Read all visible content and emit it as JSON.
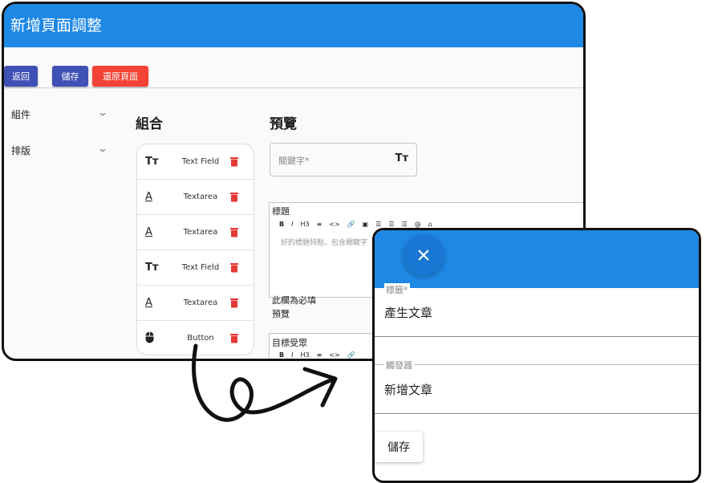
{
  "app": {
    "title": "新增頁面調整"
  },
  "toolbar": {
    "back_label": "返回",
    "save_label": "儲存",
    "reset_label": "還原頁面",
    "colors": {
      "primary": "#3f51b5",
      "danger": "#f44336"
    }
  },
  "sidebar": {
    "items": [
      {
        "label": "組件"
      },
      {
        "label": "排版"
      }
    ]
  },
  "palette": {
    "title": "組合",
    "items": [
      {
        "icon": "text-field-icon",
        "label": "Text Field"
      },
      {
        "icon": "textarea-icon",
        "label": "Textarea"
      },
      {
        "icon": "textarea-icon",
        "label": "Textarea"
      },
      {
        "icon": "text-field-icon",
        "label": "Text Field"
      },
      {
        "icon": "textarea-icon",
        "label": "Textarea"
      },
      {
        "icon": "mouse-icon",
        "label": "Button"
      }
    ]
  },
  "preview": {
    "title": "預覽",
    "keyword_placeholder": "關鍵字*",
    "editor1": {
      "label": "標題",
      "placeholder": "好的標題特點，包含關鍵字",
      "required_note": "此欄為必填",
      "footer": "預覽",
      "toolbar": [
        "B",
        "I",
        "H3",
        "≡",
        "<>",
        "🔗",
        "▣",
        "☰",
        "☰",
        "☰",
        "@",
        "⌂"
      ]
    },
    "editor2": {
      "label": "目標受眾",
      "toolbar": [
        "B",
        "I",
        "H3",
        "≡",
        "<>",
        "🔗"
      ]
    }
  },
  "dialog": {
    "fields": [
      {
        "label": "標籤*",
        "value": "產生文章"
      },
      {
        "label": "觸發器",
        "value": "新增文章"
      }
    ],
    "save_label": "儲存"
  },
  "colors": {
    "appbar": "#1e88e5",
    "delete": "#e53935"
  }
}
